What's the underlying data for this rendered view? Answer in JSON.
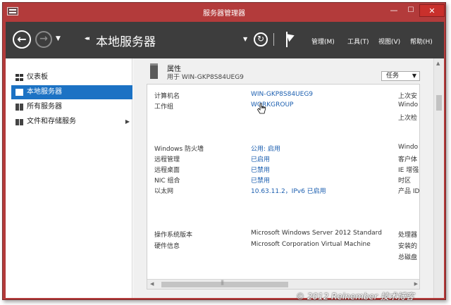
{
  "window": {
    "title": "服务器管理器"
  },
  "navbar": {
    "page_title": "本地服务器",
    "menus": [
      "管理(M)",
      "工具(T)",
      "视图(V)",
      "帮助(H)"
    ]
  },
  "sidebar": {
    "items": [
      {
        "label": "仪表板",
        "active": false
      },
      {
        "label": "本地服务器",
        "active": true
      },
      {
        "label": "所有服务器",
        "active": false
      },
      {
        "label": "文件和存储服务",
        "active": false
      }
    ]
  },
  "properties": {
    "header": "属性",
    "subtitle": "用于 WIN-GKP8S84UEG9",
    "tasks_label": "任务",
    "rows": [
      {
        "label": "计算机名",
        "value": "WIN-GKP8S84UEG9",
        "right": "上次安"
      },
      {
        "label": "工作组",
        "value": "WORKGROUP",
        "right": "Windo"
      },
      {
        "label": "",
        "value": "",
        "right": "上次检"
      },
      {
        "label": "Windows 防火墙",
        "value": "公用: 启用",
        "right": "Windo"
      },
      {
        "label": "远程管理",
        "value": "已启用",
        "right": "客户体"
      },
      {
        "label": "远程桌面",
        "value": "已禁用",
        "right": "IE 增强"
      },
      {
        "label": "NIC 组合",
        "value": "已禁用",
        "right": "时区"
      },
      {
        "label": "以太网",
        "value": "10.63.11.2，IPv6 已启用",
        "right": "产品 ID"
      },
      {
        "label": "操作系统版本",
        "value": "Microsoft Windows Server 2012 Standard",
        "right": "处理器"
      },
      {
        "label": "硬件信息",
        "value": "Microsoft Corporation Virtual Machine",
        "right": "安装的"
      },
      {
        "label": "",
        "value": "",
        "right": "总磁盘"
      }
    ]
  },
  "watermark": "© 2012 Reinember 技术博客",
  "colors": {
    "titlebar": "#b33b3b",
    "navbar": "#3d3d3d",
    "accent": "#1c72c4",
    "link": "#1c5fb0"
  }
}
